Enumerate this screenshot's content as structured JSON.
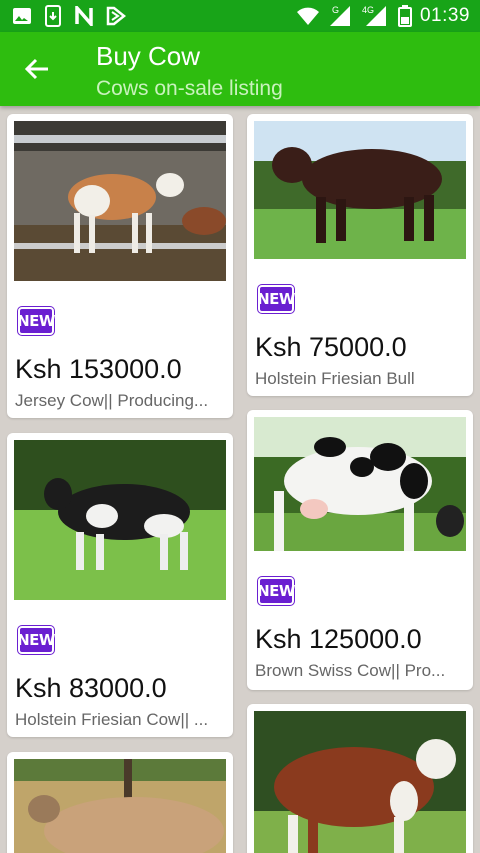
{
  "status_bar": {
    "time": "01:39",
    "left_icons": [
      "image-icon",
      "phone-icon",
      "nfc-icon",
      "tag-icon"
    ],
    "network": "4G",
    "signal_label": "G"
  },
  "app_bar": {
    "title": "Buy Cow",
    "subtitle": "Cows on-sale listing"
  },
  "colors": {
    "status_bar": "#18a418",
    "app_bar": "#2ebd0f",
    "badge": "#6a1fd1",
    "background": "#d5d0cb"
  },
  "listings": [
    {
      "badge": "NEW",
      "price": "Ksh 153000.0",
      "description": "Jersey  Cow|| Producing..."
    },
    {
      "badge": "NEW",
      "price": "Ksh 75000.0",
      "description": "Holstein Friesian  Bull"
    },
    {
      "badge": "NEW",
      "price": "Ksh 83000.0",
      "description": "Holstein Friesian  Cow|| ..."
    },
    {
      "badge": "NEW",
      "price": "Ksh 125000.0",
      "description": "Brown Swiss  Cow|| Pro..."
    }
  ]
}
